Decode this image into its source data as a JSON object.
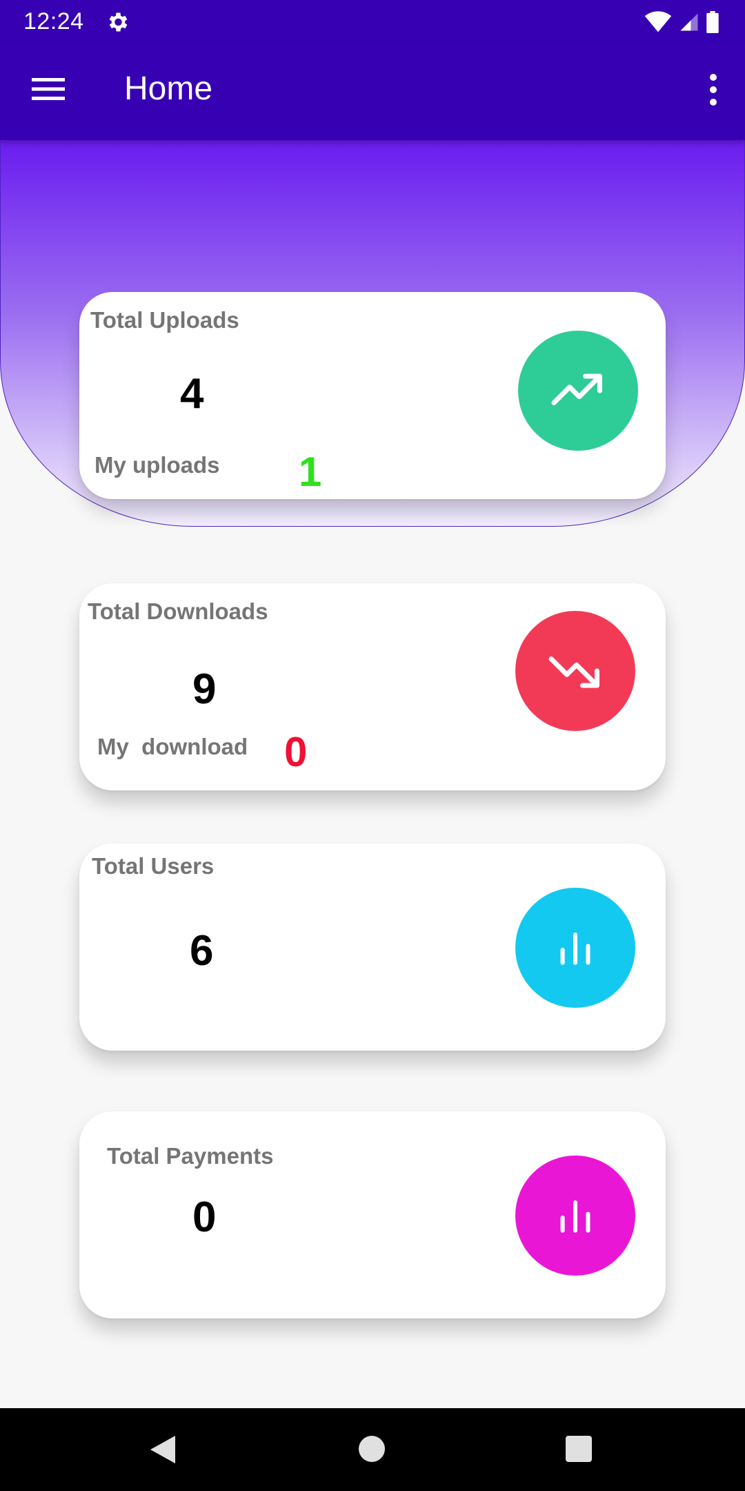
{
  "status_bar": {
    "time": "12:24"
  },
  "app_bar": {
    "title": "Home"
  },
  "cards": {
    "uploads": {
      "label": "Total Uploads",
      "value": "4",
      "sub_label": "My uploads",
      "sub_value": "1",
      "sub_color": "#2ee11b",
      "icon": "trending-up-icon",
      "color": "#2ecc97"
    },
    "downloads": {
      "label": "Total Downloads",
      "value": "9",
      "sub_label": "My  download",
      "sub_value": "0",
      "sub_color": "#ef1133",
      "icon": "trending-down-icon",
      "color": "#f23a57"
    },
    "users": {
      "label": "Total Users",
      "value": "6",
      "icon": "bar-chart-icon",
      "color": "#13c9f0"
    },
    "payments": {
      "label": "Total Payments",
      "value": "0",
      "icon": "bar-chart-icon",
      "color": "#ea16d6"
    }
  },
  "colors": {
    "primary": "#3700b3",
    "hero_top": "#6a1bef"
  }
}
